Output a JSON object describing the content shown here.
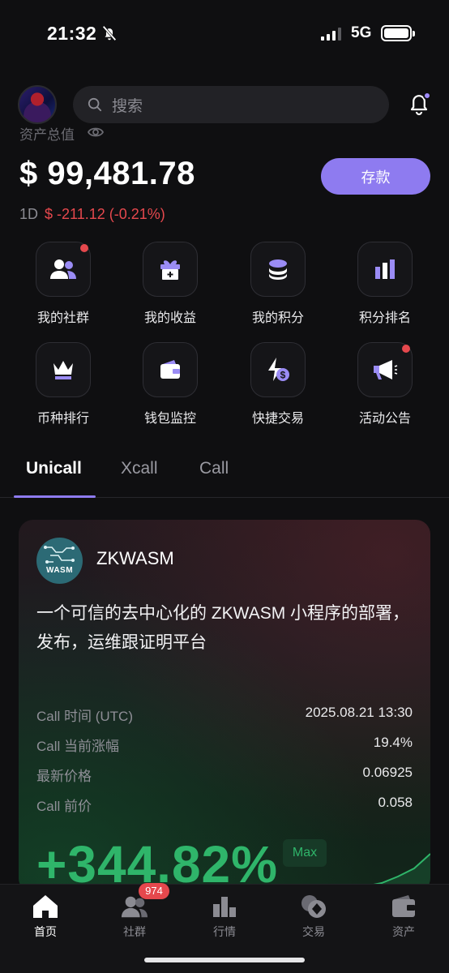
{
  "status_bar": {
    "time": "21:32",
    "network": "5G"
  },
  "header": {
    "search_placeholder": "搜索"
  },
  "assets": {
    "label": "资产总值",
    "balance": "$ 99,481.78",
    "period": "1D",
    "change": "$ -211.12 (-0.21%)",
    "deposit_label": "存款"
  },
  "grid": [
    {
      "label": "我的社群",
      "icon": "community-icon",
      "dot": true
    },
    {
      "label": "我的收益",
      "icon": "gift-icon",
      "dot": false
    },
    {
      "label": "我的积分",
      "icon": "coins-stack-icon",
      "dot": false
    },
    {
      "label": "积分排名",
      "icon": "bar-chart-icon",
      "dot": false
    },
    {
      "label": "币种排行",
      "icon": "crown-icon",
      "dot": false
    },
    {
      "label": "钱包监控",
      "icon": "wallet-icon",
      "dot": false
    },
    {
      "label": "快捷交易",
      "icon": "lightning-dollar-icon",
      "dot": false
    },
    {
      "label": "活动公告",
      "icon": "megaphone-icon",
      "dot": true
    }
  ],
  "tabs": [
    "Unicall",
    "Xcall",
    "Call"
  ],
  "card": {
    "logo_text": "WASM",
    "name": "ZKWASM",
    "description": "一个可信的去中心化的 ZKWASM 小程序的部署，发布，运维跟证明平台",
    "rows": [
      {
        "k": "Call 时间 (UTC)",
        "v": "2025.08.21 13:30"
      },
      {
        "k": "Call 当前涨幅",
        "v": "19.4%"
      },
      {
        "k": "最新价格",
        "v": "0.06925"
      },
      {
        "k": "Call 前价",
        "v": "0.058"
      }
    ],
    "max_change": "+344.82%",
    "max_label": "Max"
  },
  "bottom_nav": {
    "items": [
      {
        "label": "首页",
        "icon": "home-icon"
      },
      {
        "label": "社群",
        "icon": "community-icon"
      },
      {
        "label": "行情",
        "icon": "market-icon"
      },
      {
        "label": "交易",
        "icon": "trade-icon"
      },
      {
        "label": "资产",
        "icon": "wallet-icon"
      }
    ],
    "community_badge": "974"
  },
  "colors": {
    "accent": "#8e7bf0",
    "down": "#e5484d",
    "up": "#2fb56a",
    "background": "#0f0f11"
  }
}
